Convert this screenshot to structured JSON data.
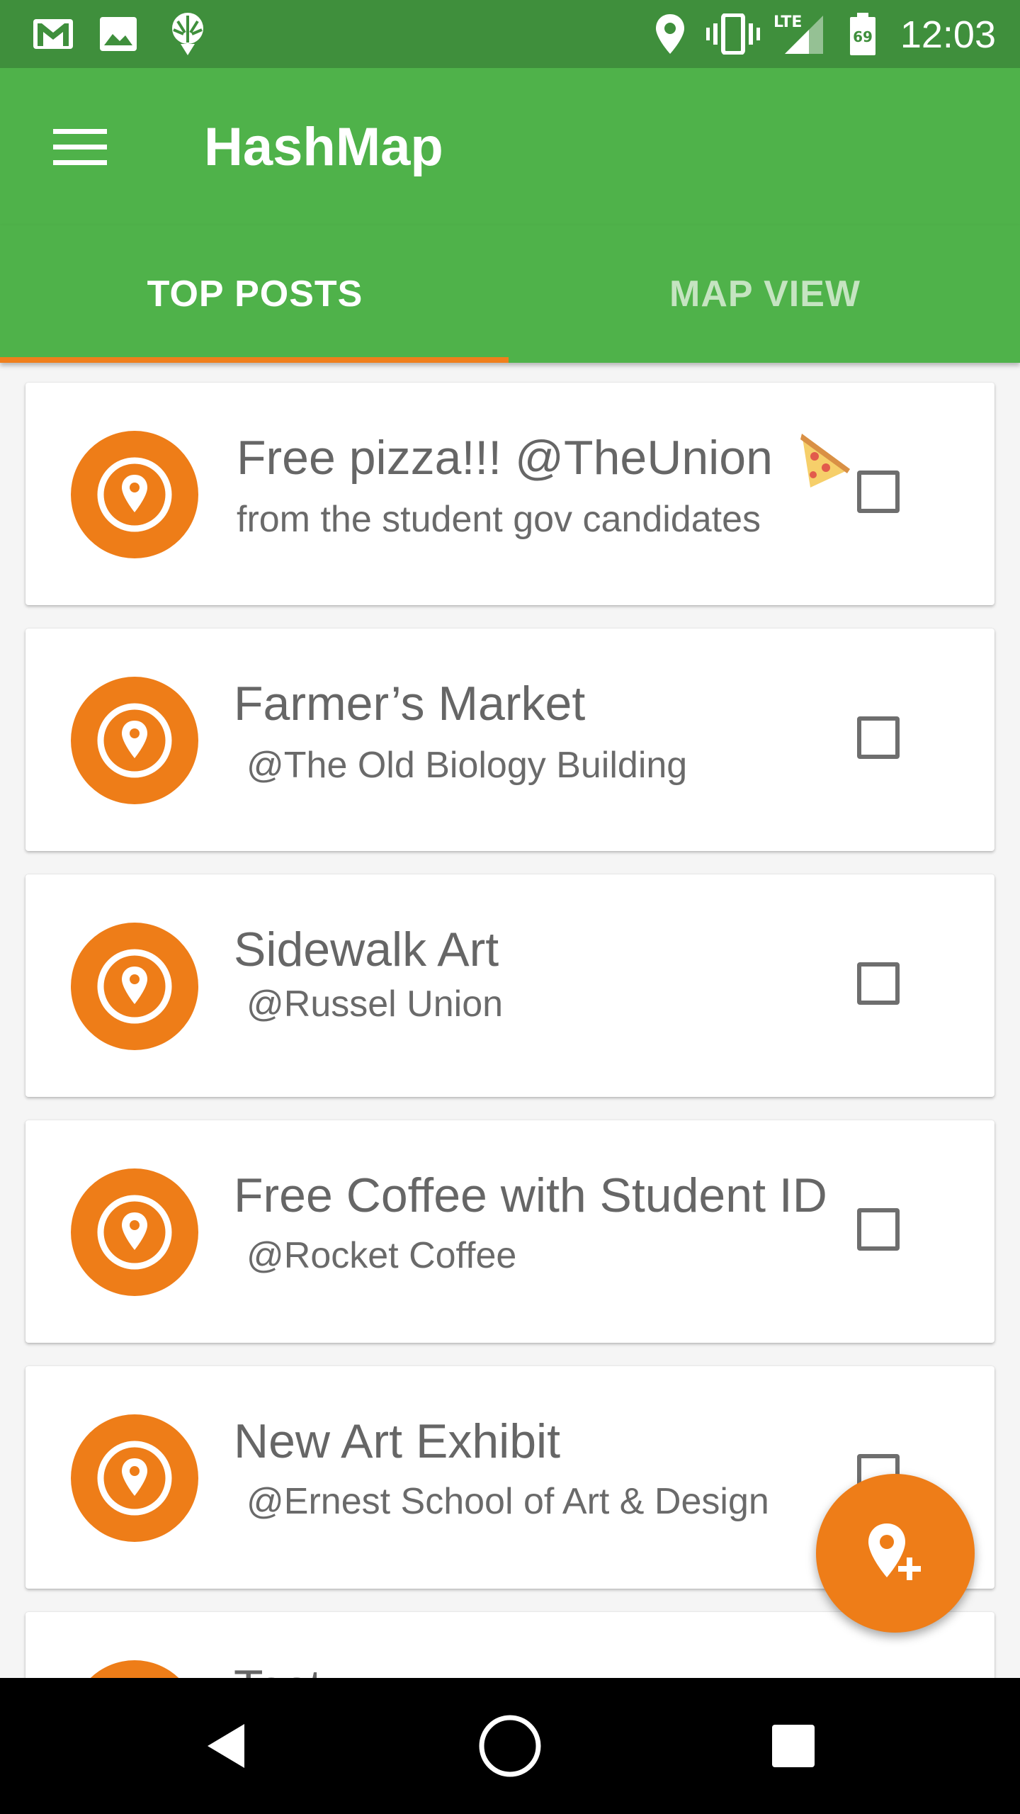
{
  "status_bar": {
    "time": "12:03",
    "battery_level": "69",
    "network": "LTE",
    "icons": [
      "gmail-icon",
      "gallery-icon",
      "app-notification-icon",
      "location-icon",
      "vibrate-icon",
      "signal-icon",
      "battery-icon"
    ]
  },
  "app_bar": {
    "title": "HashMap",
    "menu_icon": "hamburger-menu-icon"
  },
  "tabs": [
    {
      "label": "TOP POSTS",
      "selected": true
    },
    {
      "label": "MAP VIEW",
      "selected": false
    }
  ],
  "posts": [
    {
      "title": "Free pizza!!! @TheUnion",
      "subtitle": "from the student gov candidates",
      "emoji": "pizza",
      "checked": false
    },
    {
      "title": "Farmer’s Market",
      "subtitle": "@The Old Biology Building",
      "checked": false
    },
    {
      "title": "Sidewalk Art",
      "subtitle": "@Russel Union",
      "checked": false
    },
    {
      "title": "Free Coffee with Student ID",
      "subtitle": "@Rocket Coffee",
      "checked": false
    },
    {
      "title": "New Art Exhibit",
      "subtitle": "@Ernest School of Art & Design",
      "checked": false
    },
    {
      "title": "Test",
      "subtitle": "",
      "checked": false
    }
  ],
  "fab": {
    "icon": "add-location-icon"
  },
  "nav_bar": {
    "icons": [
      "back-icon",
      "home-icon",
      "recents-icon"
    ]
  },
  "colors": {
    "status_bar": "#3f8f3c",
    "primary": "#4fb24a",
    "accent": "#ee7d18",
    "tab_indicator": "#f07f1c"
  }
}
